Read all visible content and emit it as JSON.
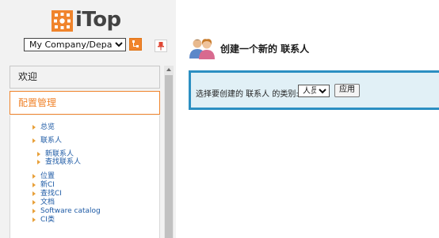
{
  "app": {
    "logo_text": "iTop",
    "brand_color": "#f0842c",
    "accent_color": "#2b8fc2"
  },
  "sidebar": {
    "org_select": {
      "value": "My Company/Department"
    },
    "org_button_icon": "org-tree-icon",
    "pin_icon": "pin-icon",
    "welcome_label": "欢迎",
    "config_label": "配置管理",
    "menu": [
      {
        "label": "总览"
      },
      {
        "label": "联系人"
      },
      {
        "label": "新联系人"
      },
      {
        "label": "查找联系人"
      },
      {
        "label": "位置"
      },
      {
        "label": "新CI"
      },
      {
        "label": "查找CI"
      },
      {
        "label": "文档"
      },
      {
        "label": "Software catalog"
      },
      {
        "label": "CI类"
      }
    ]
  },
  "main": {
    "title_icon": "contacts-icon",
    "title": "创建一个新的 联系人",
    "form": {
      "label": "选择要创建的 联系人 的类别:",
      "type_select": {
        "value": "人员"
      },
      "apply_label": "应用"
    }
  }
}
